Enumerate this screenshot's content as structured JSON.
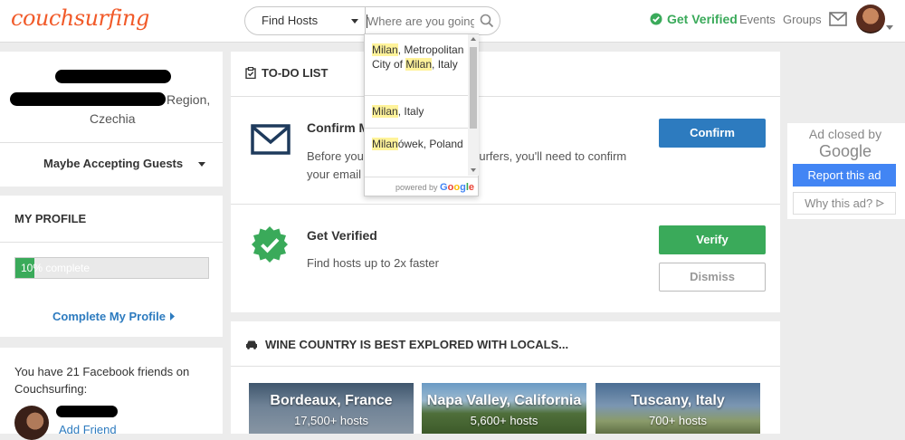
{
  "header": {
    "logo": "couchsurfing",
    "find_select": "Find Hosts",
    "search_placeholder": "Where are you going?",
    "get_verified": "Get Verified",
    "events": "Events",
    "groups": "Groups"
  },
  "autocomplete": {
    "items": [
      {
        "match": "Milan",
        "rest": ", Metropolitan City of ",
        "match2": "Milan",
        "rest2": ", Italy"
      },
      {
        "match": "Milan",
        "rest": ", Italy"
      },
      {
        "match": "Milan",
        "rest": "ówek, Poland"
      }
    ],
    "powered_by": "powered by",
    "google": "Google"
  },
  "profile_card": {
    "region_suffix": "Region,",
    "country": "Czechia",
    "status": "Maybe Accepting Guests"
  },
  "my_profile": {
    "title": "MY PROFILE",
    "progress_label": "10% complete",
    "progress_fraction": 0.1,
    "complete_link": "Complete My Profile"
  },
  "friends": {
    "text": "You have 21 Facebook friends on Couchsurfing:",
    "add_friend": "Add Friend"
  },
  "todo": {
    "title": "TO-DO LIST",
    "confirm_title": "Confirm M",
    "confirm_desc_a": "Before you",
    "confirm_desc_b": "uchsurfers, you'll need to confirm",
    "confirm_desc_c": "your email a",
    "confirm_button": "Confirm",
    "verified_title": "Get Verified",
    "verified_desc": "Find hosts up to 2x faster",
    "verify_button": "Verify",
    "dismiss_button": "Dismiss"
  },
  "wine": {
    "title": "WINE COUNTRY IS BEST EXPLORED WITH LOCALS...",
    "tiles": [
      {
        "name": "Bordeaux, France",
        "hosts": "17,500+ hosts"
      },
      {
        "name": "Napa Valley, California",
        "hosts": "5,600+ hosts"
      },
      {
        "name": "Tuscany, Italy",
        "hosts": "700+ hosts"
      }
    ]
  },
  "ad": {
    "closed_by": "Ad closed by",
    "google": "Google",
    "report": "Report this ad",
    "why": "Why this ad?"
  },
  "colors": {
    "brand": "#f15a29",
    "blue": "#2d7bbf",
    "green": "#3aaa5a",
    "highlight": "#fff39a"
  }
}
